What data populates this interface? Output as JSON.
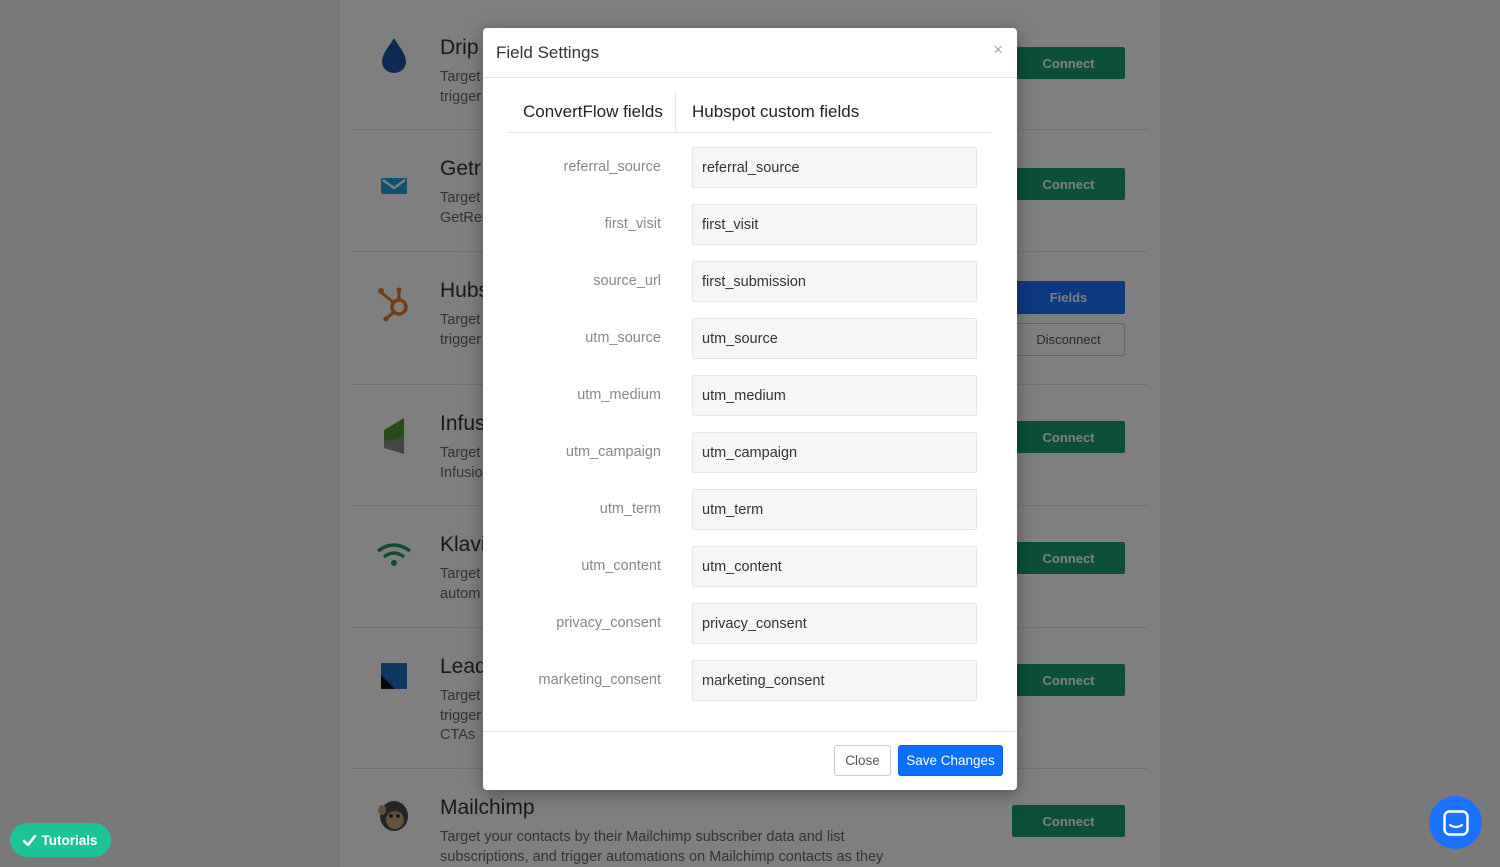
{
  "colors": {
    "connect_green": "#199e6e",
    "fields_blue": "#1a73ff",
    "save_blue": "#0b6fff",
    "tutorials_green": "#1ec39a"
  },
  "background": {
    "integrations": [
      {
        "name": "Drip",
        "desc": "Target trigger",
        "logo": "drip-icon",
        "button": "Connect"
      },
      {
        "name": "Getr",
        "desc": "Target GetRes",
        "logo": "getresponse-icon",
        "button": "Connect"
      },
      {
        "name": "Hubs",
        "desc": "Target trigger",
        "logo": "hubspot-icon",
        "button": "Fields",
        "secondary_button": "Disconnect"
      },
      {
        "name": "Infus",
        "desc": "Target Infusio",
        "logo": "infusionsoft-icon",
        "button": "Connect"
      },
      {
        "name": "Klavi",
        "desc": "Target autom",
        "logo": "klaviyo-icon",
        "button": "Connect"
      },
      {
        "name": "Lead",
        "desc": "Target trigger CTAs",
        "logo": "leadpages-icon",
        "button": "Connect"
      },
      {
        "name": "Mailchimp",
        "desc": "Target your contacts by their Mailchimp subscriber data and list subscriptions, and trigger automations on Mailchimp contacts as they",
        "logo": "mailchimp-icon",
        "button": "Connect"
      }
    ]
  },
  "modal": {
    "title": "Field Settings",
    "close_glyph": "×",
    "left_heading": "ConvertFlow fields",
    "right_heading": "Hubspot custom fields",
    "fields": [
      {
        "label": "referral_source",
        "value": "referral_source"
      },
      {
        "label": "first_visit",
        "value": "first_visit"
      },
      {
        "label": "source_url",
        "value": "first_submission"
      },
      {
        "label": "utm_source",
        "value": "utm_source"
      },
      {
        "label": "utm_medium",
        "value": "utm_medium"
      },
      {
        "label": "utm_campaign",
        "value": "utm_campaign"
      },
      {
        "label": "utm_term",
        "value": "utm_term"
      },
      {
        "label": "utm_content",
        "value": "utm_content"
      },
      {
        "label": "privacy_consent",
        "value": "privacy_consent"
      },
      {
        "label": "marketing_consent",
        "value": "marketing_consent"
      }
    ],
    "close_label": "Close",
    "save_label": "Save Changes"
  },
  "tutorials_label": "Tutorials",
  "chat_icon": "chat-icon"
}
